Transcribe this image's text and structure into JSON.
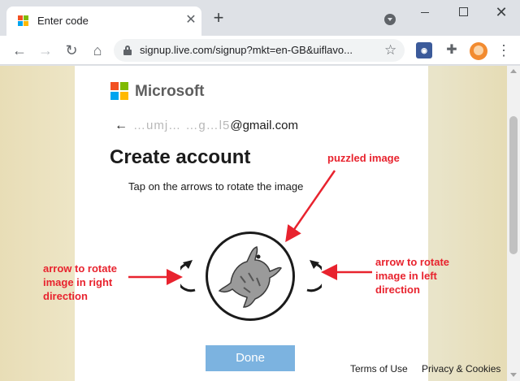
{
  "browser": {
    "tab_title": "Enter code",
    "new_tab_symbol": "+",
    "url": "signup.live.com/signup?mkt=en-GB&uiflavo...",
    "colors": {
      "ms_red": "#f25022",
      "ms_green": "#7fba00",
      "ms_blue": "#00a4ef",
      "ms_yellow": "#ffb900"
    }
  },
  "page": {
    "brand": "Microsoft",
    "email_hidden": "…umj… …g…l5",
    "email_visible": "@gmail.com",
    "heading": "Create account",
    "instruction": "Tap on the arrows to rotate the image",
    "done_label": "Done",
    "terms_label": "Terms of Use",
    "privacy_label": "Privacy & Cookies"
  },
  "annotations": {
    "top": "puzzled image",
    "left_lines": [
      "arrow to rotate",
      "image in right",
      "direction"
    ],
    "right_lines": [
      "arrow to rotate",
      "image in left",
      "direction"
    ],
    "color": "#e8232e"
  }
}
